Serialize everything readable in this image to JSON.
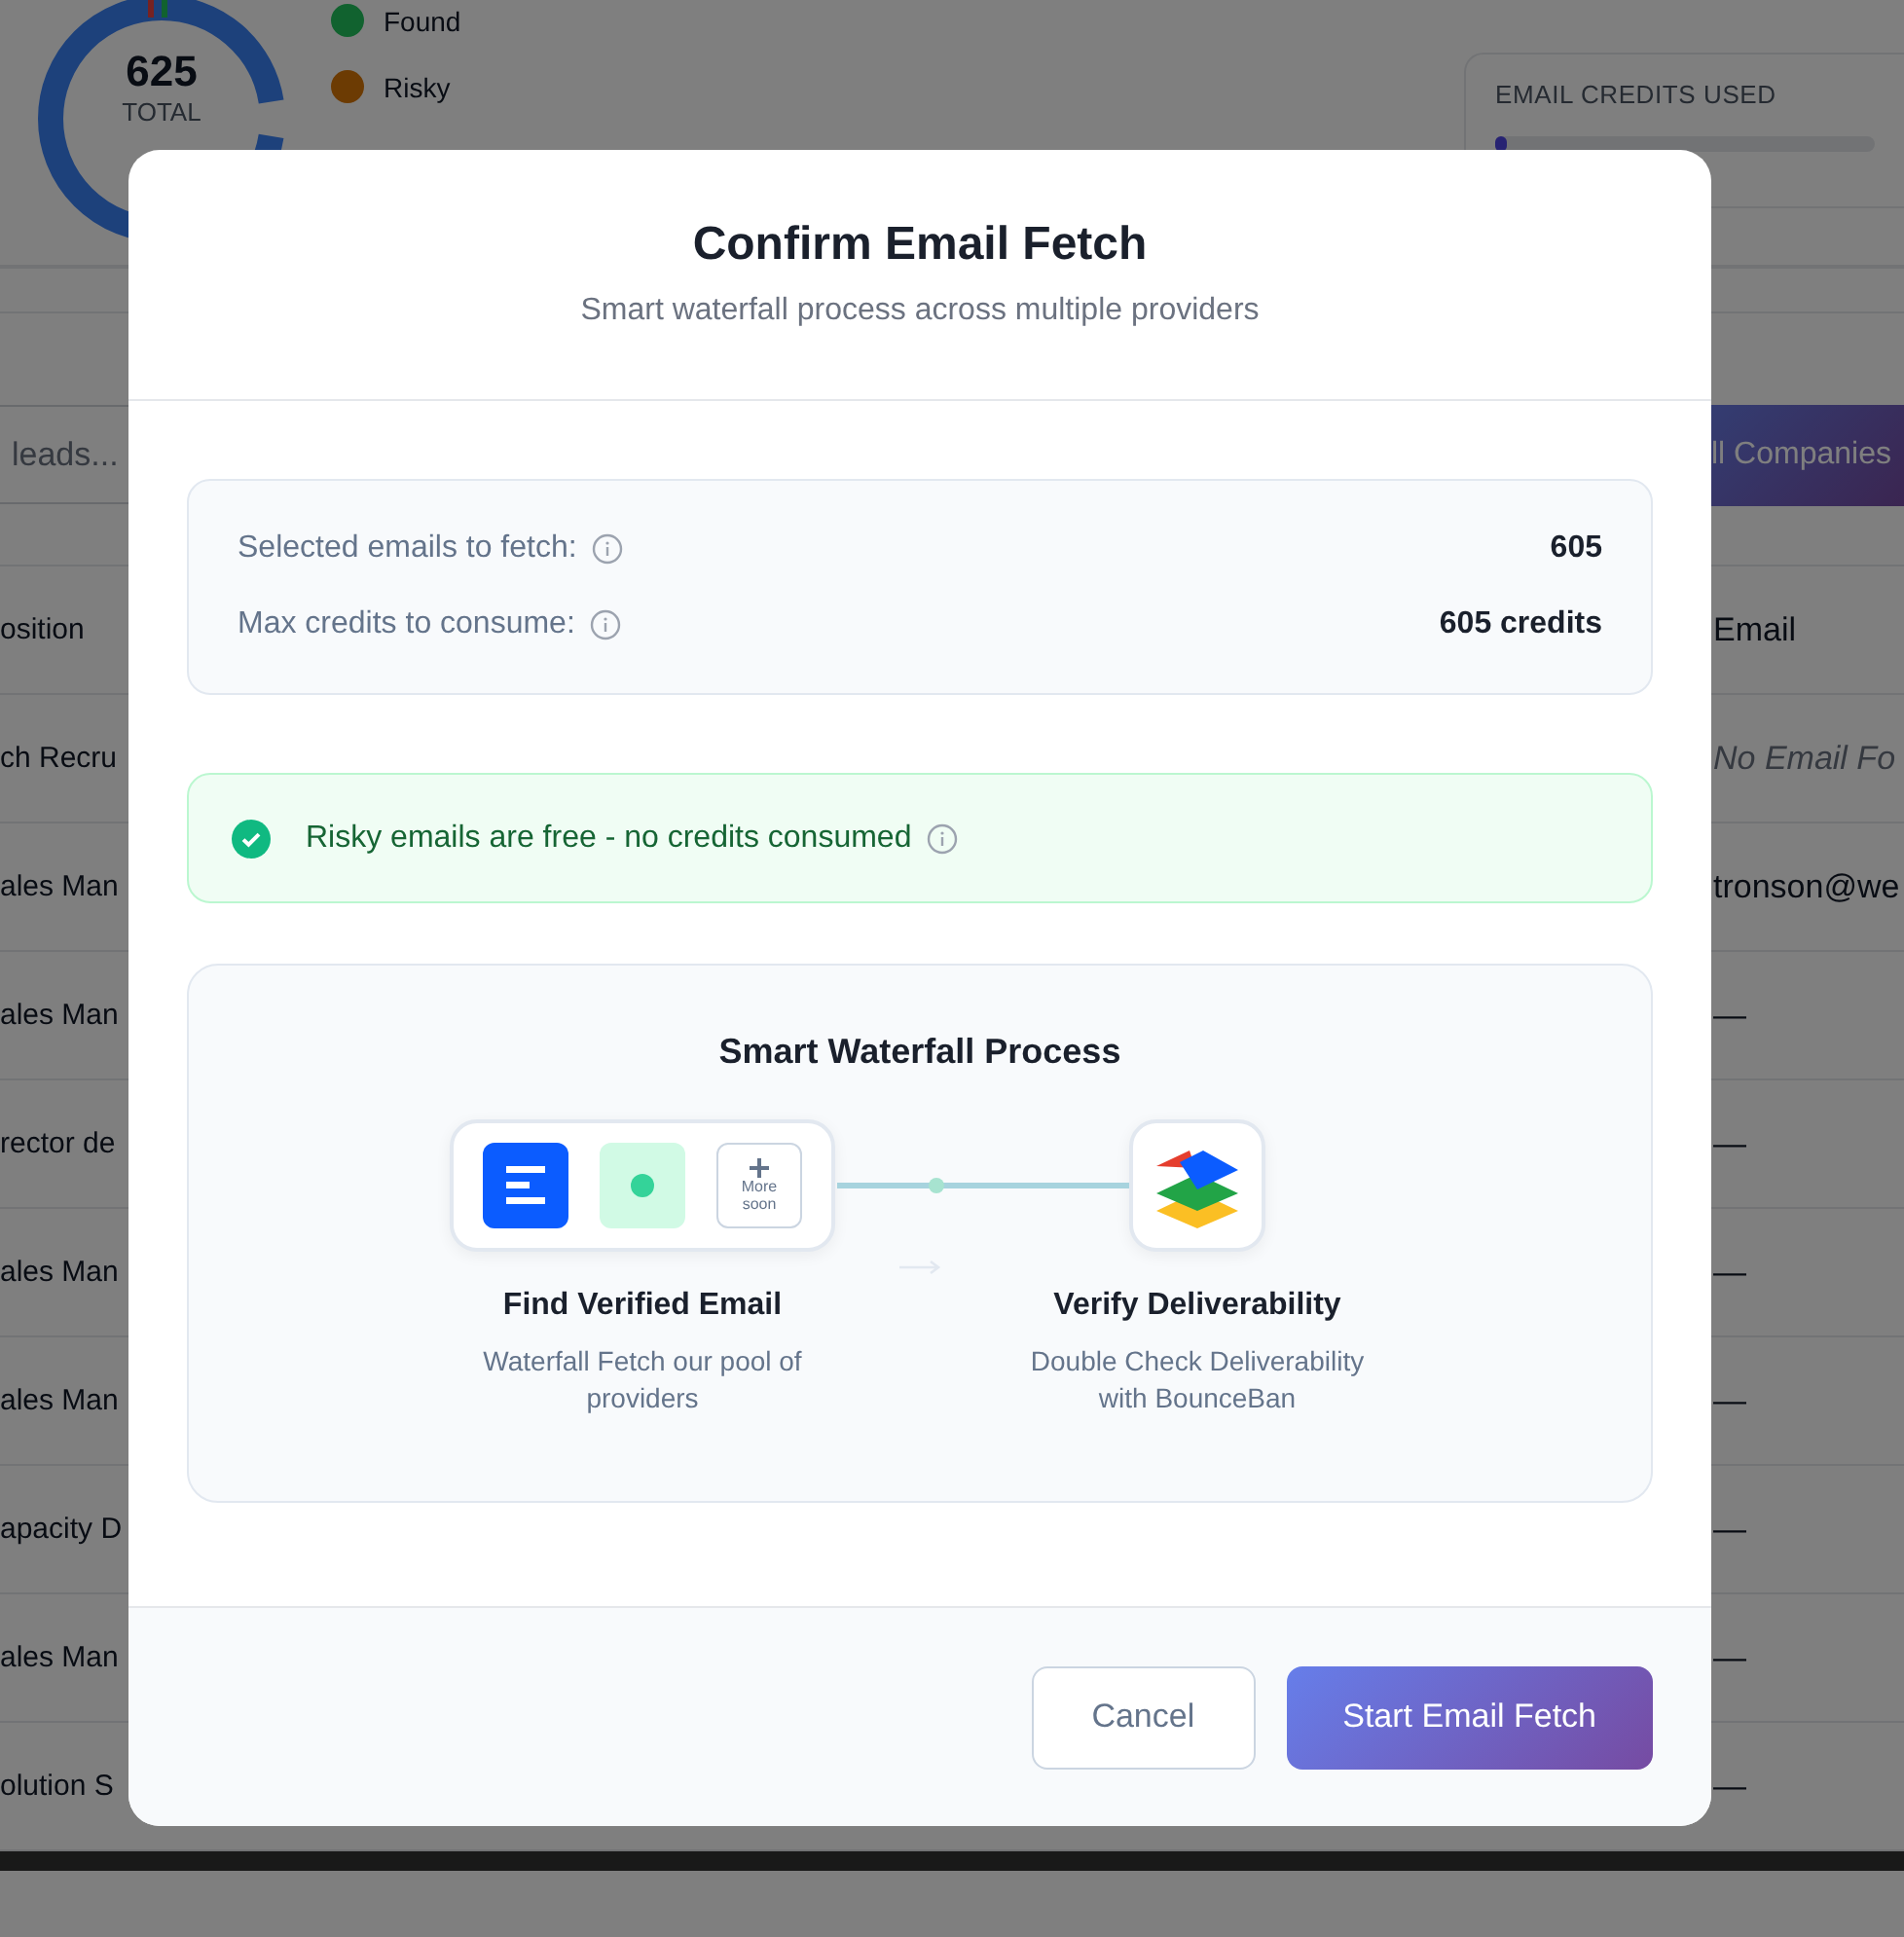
{
  "background": {
    "summary": {
      "total": "625",
      "total_label": "TOTAL",
      "legend": [
        {
          "label": "Found",
          "color": "#11622f"
        },
        {
          "label": "Risky",
          "color": "#6c3b03"
        }
      ]
    },
    "credits": {
      "title": "EMAIL CREDITS USED",
      "level": 0.03
    },
    "search": {
      "placeholder": "leads..."
    },
    "companies_button": "ll Companies",
    "table": {
      "columns": [
        "osition",
        "Email"
      ],
      "rows": [
        {
          "position": "ch Recru",
          "email": "No Email Fo",
          "missing": true
        },
        {
          "position": "ales Man",
          "email": "tronson@we",
          "missing": false
        },
        {
          "position": "ales Man",
          "email": "—",
          "missing": false
        },
        {
          "position": "rector de",
          "email": "—",
          "missing": false
        },
        {
          "position": "ales Man",
          "email": "—",
          "missing": false
        },
        {
          "position": "ales Man",
          "email": "—",
          "missing": false
        },
        {
          "position": "apacity D",
          "email": "—",
          "missing": false
        },
        {
          "position": "ales Man",
          "email": "—",
          "missing": false
        },
        {
          "position": "olution S",
          "email": "—",
          "missing": false
        }
      ]
    }
  },
  "modal": {
    "title": "Confirm Email Fetch",
    "subtitle": "Smart waterfall process across multiple providers",
    "stats": [
      {
        "label": "Selected emails to fetch:",
        "value": "605"
      },
      {
        "label": "Max credits to consume:",
        "value": "605 credits"
      }
    ],
    "notice": "Risky emails are free - no credits consumed",
    "waterfall": {
      "title": "Smart Waterfall Process",
      "more_label": "More soon",
      "steps": [
        {
          "kind": "find",
          "title": "Find Verified Email",
          "description": "Waterfall Fetch our pool of providers"
        },
        {
          "kind": "verify",
          "title": "Verify Deliverability",
          "description": "Double Check Deliverability with BounceBan"
        }
      ]
    },
    "buttons": [
      {
        "label": "Cancel",
        "kind": "secondary"
      },
      {
        "label": "Start Email Fetch",
        "kind": "primary"
      }
    ]
  }
}
